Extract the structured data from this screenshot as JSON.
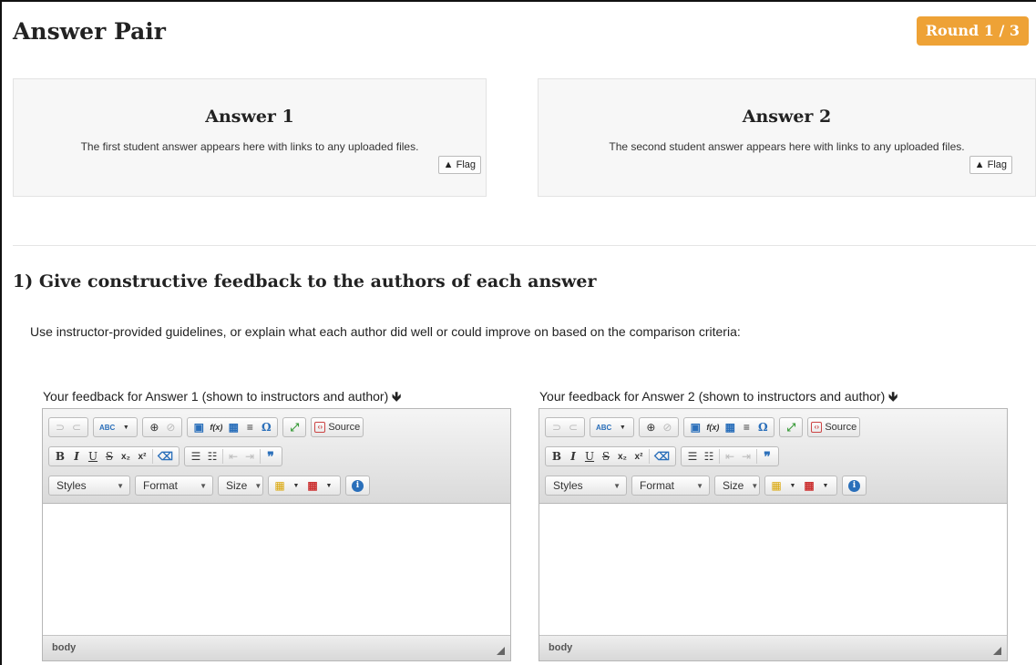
{
  "header": {
    "title": "Answer Pair",
    "round_badge": "Round 1 / 3"
  },
  "answers": [
    {
      "title": "Answer 1",
      "body": "The first student answer appears here with links to any uploaded files.",
      "flag_icon": "warning-triangle-icon",
      "flag_glyph": "▲",
      "flag_label": "Flag"
    },
    {
      "title": "Answer 2",
      "body": "The second student answer appears here with links to any uploaded files.",
      "flag_icon": "warning-triangle-icon",
      "flag_glyph": "▲",
      "flag_label": "Flag"
    }
  ],
  "section": {
    "title": "1) Give constructive feedback to the authors of each answer",
    "instructions": "Use instructor-provided guidelines, or explain what each author did well or could improve on based on the comparison criteria:"
  },
  "feedback": [
    {
      "label": "Your feedback for Answer 1 (shown to instructors and author)",
      "arrow": "🡻"
    },
    {
      "label": "Your feedback for Answer 2 (shown to instructors and author)",
      "arrow": "🡻"
    }
  ],
  "editor": {
    "toolbar": {
      "undo": "⊃",
      "redo": "⊂",
      "spellcheck": "ABC",
      "link": "⊕",
      "unlink": "⊘",
      "image": "▣",
      "formula": "f(x)",
      "table": "▦",
      "hr": "≡",
      "special_char": "Ω",
      "maximize": "⤢",
      "source_icon": "‹›",
      "source": "Source",
      "bold": "B",
      "italic": "I",
      "underline": "U",
      "strike": "S",
      "subscript": "x₂",
      "superscript": "x²",
      "remove_format": "⌫",
      "numbered_list": "☰",
      "bulleted_list": "☷",
      "outdent": "⇤",
      "indent": "⇥",
      "blockquote": "❞",
      "styles": "Styles",
      "format": "Format",
      "size": "Size",
      "text_color": "▦",
      "bg_color": "▦",
      "about": "i",
      "caret": "▼"
    },
    "status_path": "body"
  },
  "colors": {
    "badge": "#eea236",
    "answer_bg": "#f7f7f7",
    "link_blue": "#2a6fba"
  }
}
